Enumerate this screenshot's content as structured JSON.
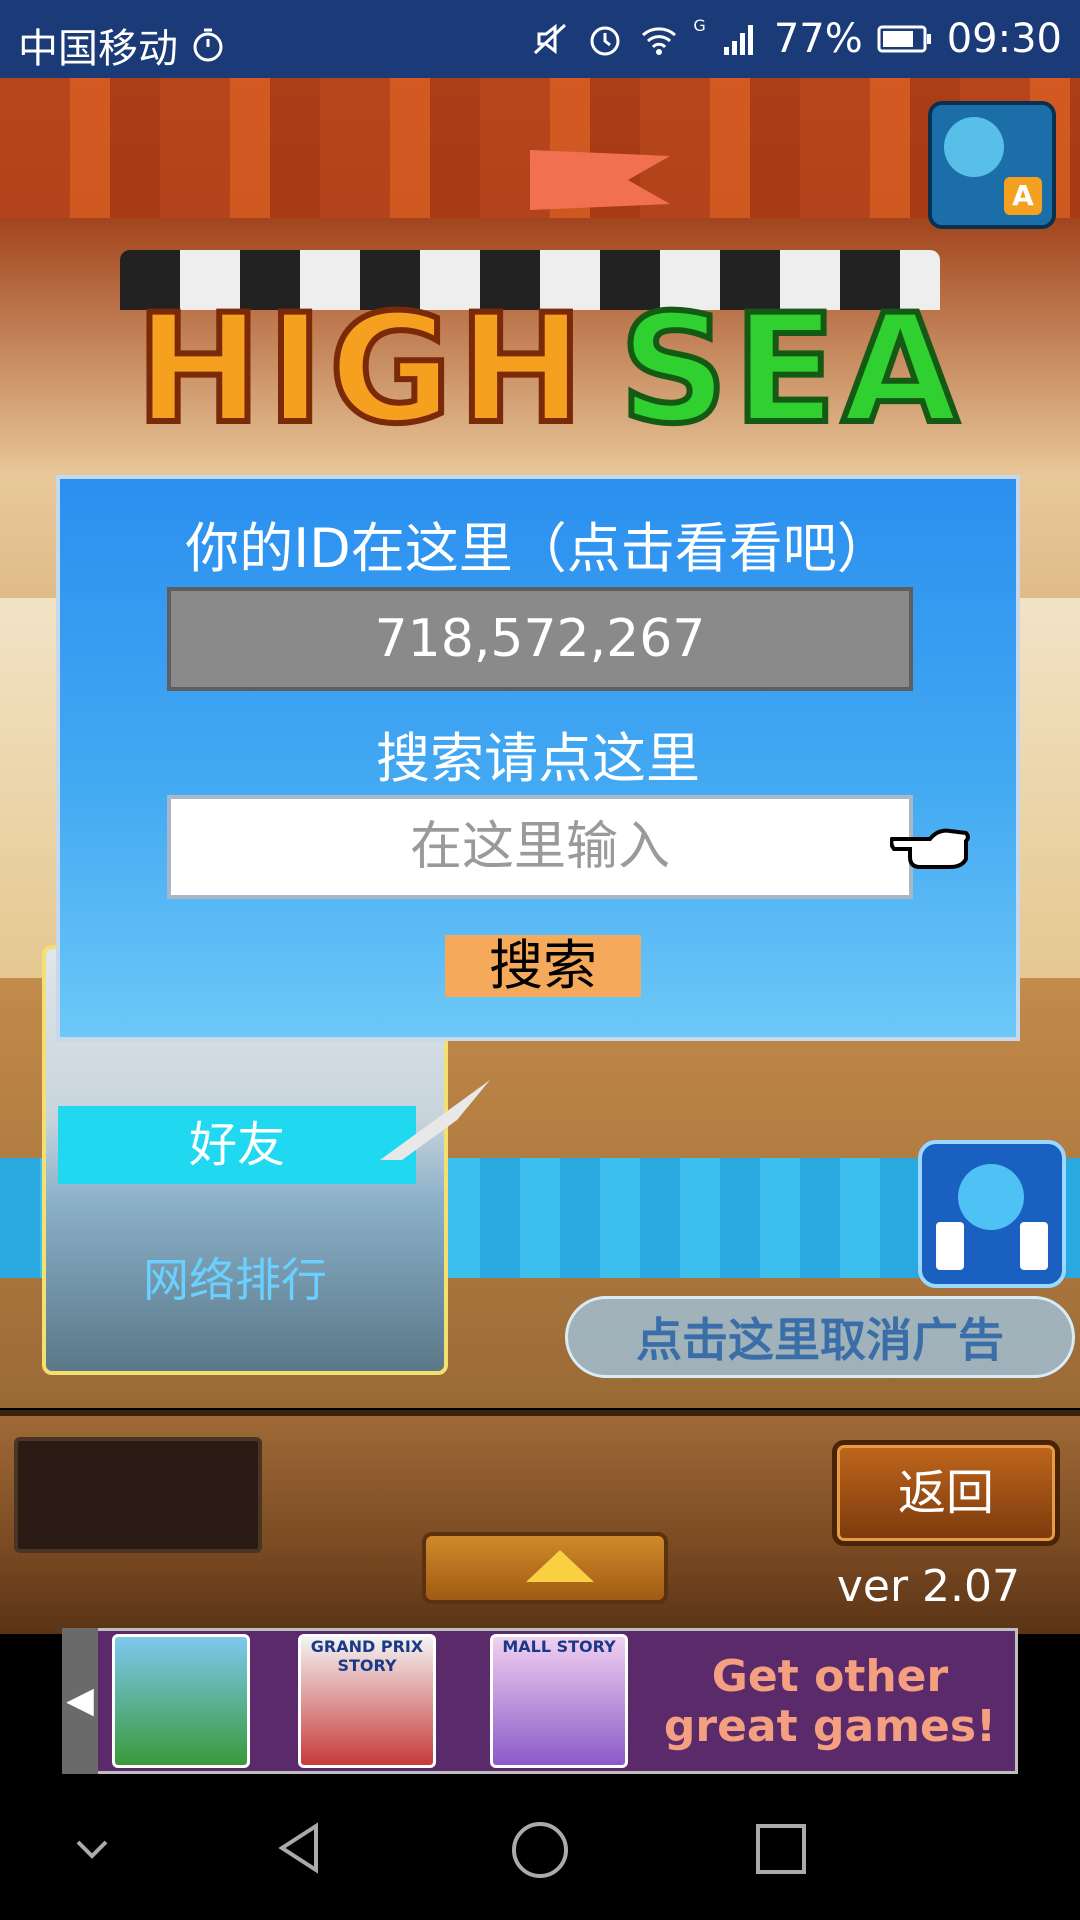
{
  "status_bar": {
    "carrier": "中国移动",
    "battery": "77%",
    "time": "09:30",
    "network": "G"
  },
  "game": {
    "logo_word1": "HIGH",
    "logo_word2": "SEA"
  },
  "dialog": {
    "title": "你的ID在这里（点击看看吧）",
    "player_id": "718,572,267",
    "search_label": "搜索请点这里",
    "search_placeholder": "在这里输入",
    "search_button": "搜索"
  },
  "panel": {
    "friends_label": "好友",
    "ranking_label": "网络排行"
  },
  "ad_cancel_label": "点击这里取消广告",
  "bottom": {
    "back_label": "返回",
    "version": "ver 2.07"
  },
  "ad_banner": {
    "games": [
      "",
      "GRAND PRIX STORY",
      "MALL STORY"
    ],
    "cta": "Get other great games!"
  },
  "colors": {
    "dialog_top": "#2b8fef",
    "dialog_bottom": "#6cc8f7",
    "search_button": "#f4aa5a",
    "friends_tab": "#20d8f0"
  }
}
